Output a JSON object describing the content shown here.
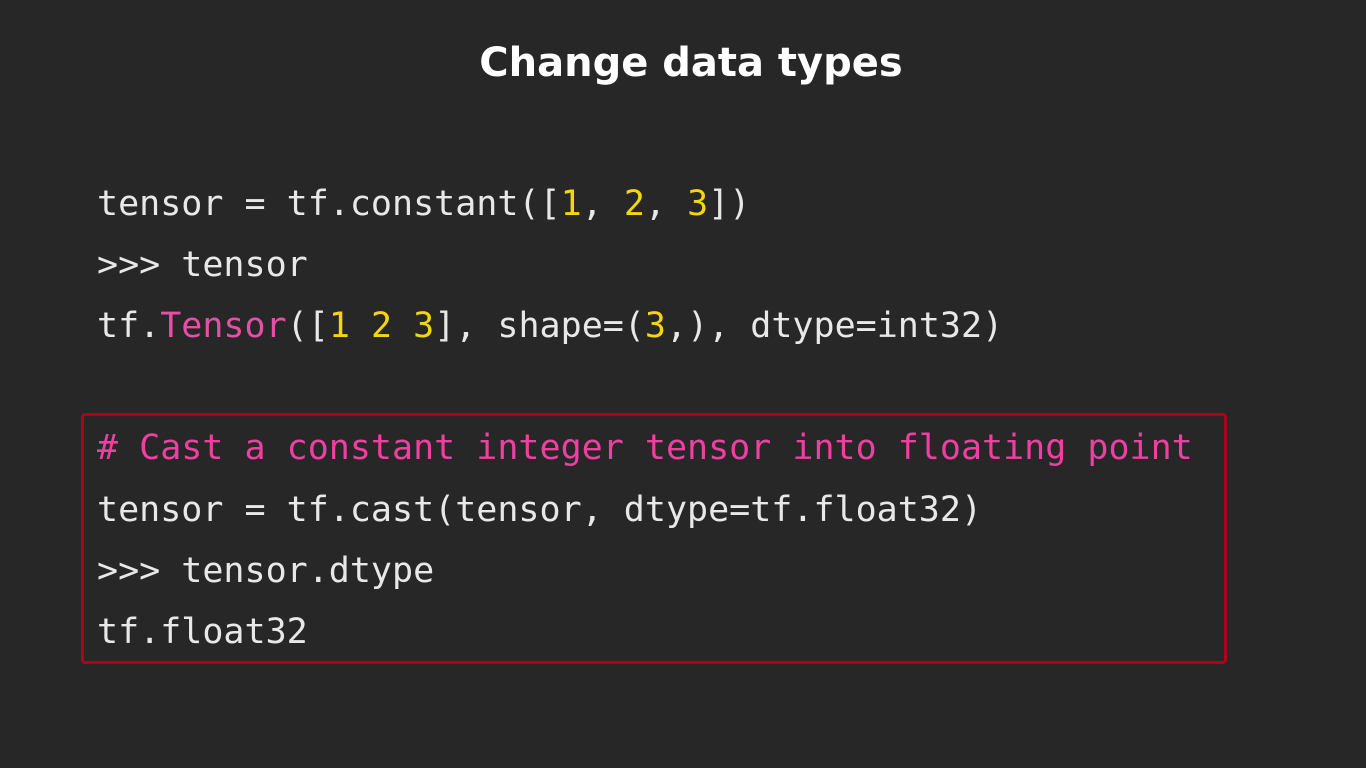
{
  "slide": {
    "title": "Change data types"
  },
  "code_block_1": {
    "line1": {
      "prefix": "tensor = tf.constant([",
      "n1": "1",
      "sep1": ", ",
      "n2": "2",
      "sep2": ", ",
      "n3": "3",
      "suffix": "])"
    },
    "line2": {
      "text": ">>> tensor"
    },
    "line3": {
      "prefix": "tf.",
      "cls": "Tensor",
      "open": "([",
      "n1": "1",
      "sp1": " ",
      "n2": "2",
      "sp2": " ",
      "n3": "3",
      "mid": "], shape=(",
      "n4": "3",
      "suffix": ",), dtype=int32)"
    }
  },
  "code_block_2": {
    "comment": "# Cast a constant integer tensor into floating point",
    "line2": "tensor = tf.cast(tensor, dtype=tf.float32)",
    "line3": ">>> tensor.dtype",
    "line4": "tf.float32"
  },
  "colors": {
    "background": "#272727",
    "text": "#e8e8e8",
    "number": "#f5d60a",
    "class_name": "#e54fa6",
    "comment": "#ef3fa0",
    "highlight_border": "#b0001c"
  }
}
